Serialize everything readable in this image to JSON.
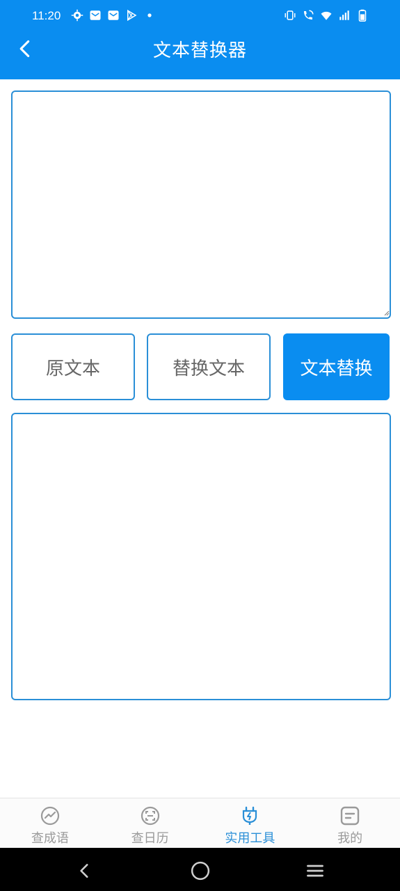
{
  "status_bar": {
    "time": "11:20",
    "left_icons": [
      "settings-icon",
      "mail-icon",
      "mail-icon",
      "play-store-icon",
      "dot-icon"
    ],
    "right_icons": [
      "vibrate-icon",
      "call-wifi-icon",
      "wifi-icon",
      "signal-icon",
      "battery-icon"
    ]
  },
  "app_bar": {
    "title": "文本替换器",
    "back_icon": "chevron-left-icon"
  },
  "editor": {
    "input_value": "",
    "output_value": ""
  },
  "buttons": {
    "original": "原文本",
    "replace_text": "替换文本",
    "do_replace": "文本替换"
  },
  "tab_bar": {
    "items": [
      {
        "label": "查成语",
        "icon": "trend-chart-icon",
        "active": false
      },
      {
        "label": "查日历",
        "icon": "face-scan-icon",
        "active": false
      },
      {
        "label": "实用工具",
        "icon": "plug-lightning-icon",
        "active": true
      },
      {
        "label": "我的",
        "icon": "note-icon",
        "active": false
      }
    ]
  },
  "colors": {
    "primary": "#0a8df0",
    "border": "#2a8fd7",
    "inactive": "#9a9a9a"
  }
}
